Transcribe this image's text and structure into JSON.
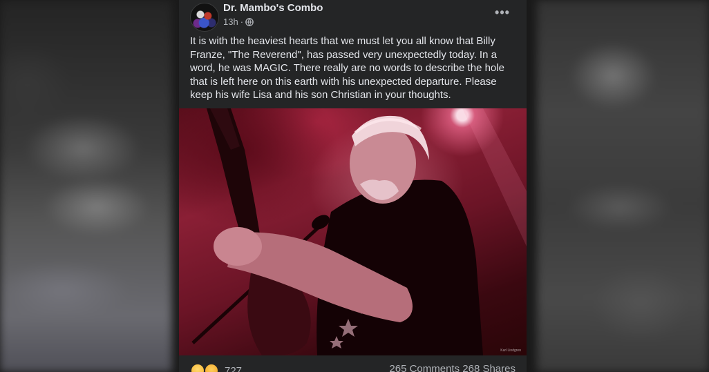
{
  "post": {
    "page_name": "Dr. Mambo's Combo",
    "timestamp": "13h",
    "separator": "·",
    "audience_icon": "globe-icon",
    "more_label": "•••",
    "text": "It is with the heaviest hearts that we must let you all know that Billy Franze, \"The Reverend\", has passed very unexpectedly today. In a word, he was MAGIC. There really are no words to describe the hole that is left here on this earth with his unexpected departure. Please keep his wife Lisa and his son Christian in your thoughts.",
    "photo_watermark": "Karl Lindgren",
    "reactions": {
      "icons": [
        "sad-reaction-icon",
        "care-reaction-icon"
      ],
      "count": "727"
    },
    "engagement": "265 Comments  268 Shares"
  },
  "colors": {
    "card_background": "#242526",
    "primary_text": "#e4e6eb",
    "secondary_text": "#b0b3b8"
  }
}
